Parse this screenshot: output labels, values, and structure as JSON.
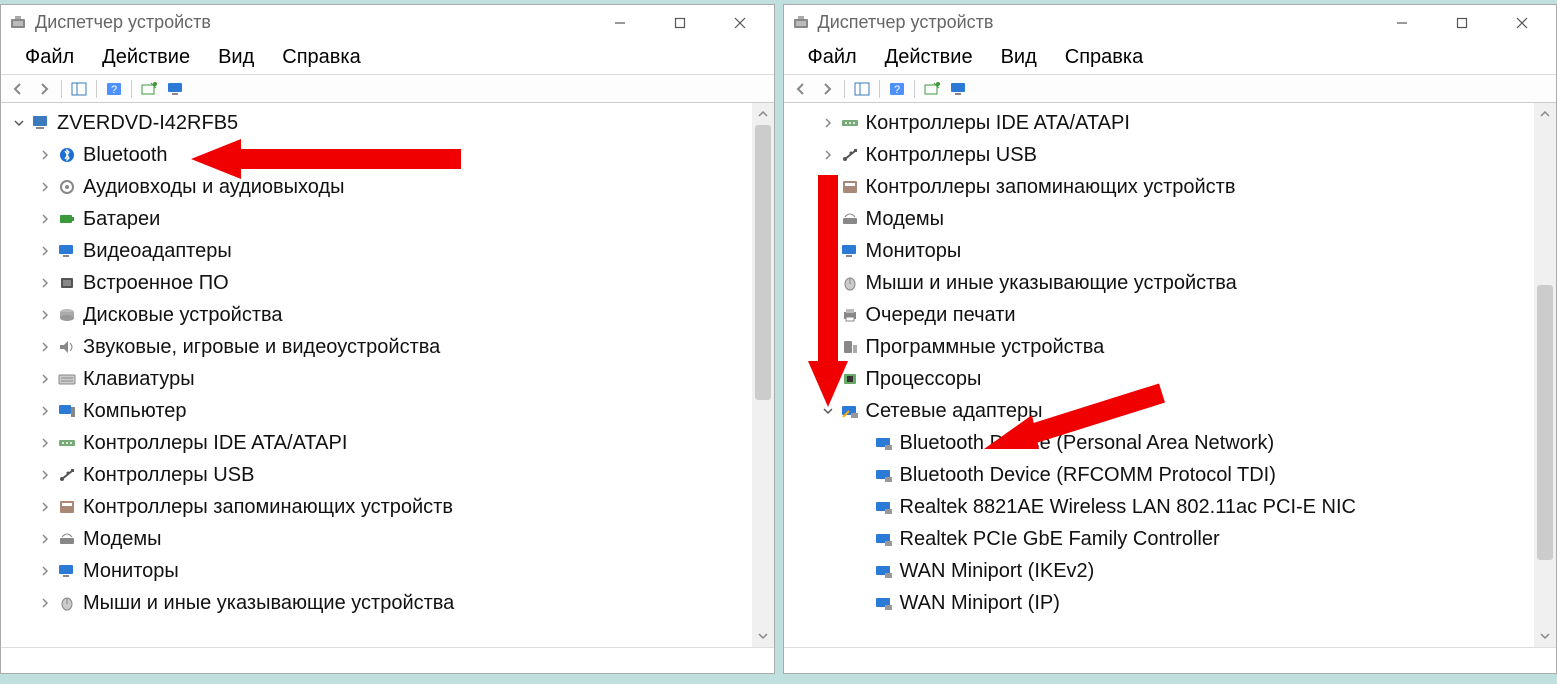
{
  "window_title": "Диспетчер устройств",
  "menubar": {
    "file": "Файл",
    "action": "Действие",
    "view": "Вид",
    "help": "Справка"
  },
  "left": {
    "root": "ZVERDVD-I42RFB5",
    "items": [
      {
        "label": "Bluetooth",
        "icon": "bluetooth"
      },
      {
        "label": "Аудиовходы и аудиовыходы",
        "icon": "audio"
      },
      {
        "label": "Батареи",
        "icon": "battery"
      },
      {
        "label": "Видеоадаптеры",
        "icon": "display"
      },
      {
        "label": "Встроенное ПО",
        "icon": "chip"
      },
      {
        "label": "Дисковые устройства",
        "icon": "disk"
      },
      {
        "label": "Звуковые, игровые и видеоустройства",
        "icon": "speaker"
      },
      {
        "label": "Клавиатуры",
        "icon": "keyboard"
      },
      {
        "label": "Компьютер",
        "icon": "computer"
      },
      {
        "label": "Контроллеры IDE ATA/ATAPI",
        "icon": "ide"
      },
      {
        "label": "Контроллеры USB",
        "icon": "usb"
      },
      {
        "label": "Контроллеры запоминающих устройств",
        "icon": "storage"
      },
      {
        "label": "Модемы",
        "icon": "modem"
      },
      {
        "label": "Мониторы",
        "icon": "monitor"
      },
      {
        "label": "Мыши и иные указывающие устройства",
        "icon": "mouse"
      }
    ]
  },
  "right": {
    "items": [
      {
        "label": "Контроллеры IDE ATA/ATAPI",
        "icon": "ide",
        "exp": "closed"
      },
      {
        "label": "Контроллеры USB",
        "icon": "usb",
        "exp": "closed"
      },
      {
        "label": "Контроллеры запоминающих устройств",
        "icon": "storage",
        "exp": "closed"
      },
      {
        "label": "Модемы",
        "icon": "modem",
        "exp": "closed"
      },
      {
        "label": "Мониторы",
        "icon": "monitor",
        "exp": "closed"
      },
      {
        "label": "Мыши и иные указывающие устройства",
        "icon": "mouse",
        "exp": "closed"
      },
      {
        "label": "Очереди печати",
        "icon": "print",
        "exp": "closed"
      },
      {
        "label": "Программные устройства",
        "icon": "software",
        "exp": "closed"
      },
      {
        "label": "Процессоры",
        "icon": "cpu",
        "exp": "closed"
      },
      {
        "label": "Сетевые адаптеры",
        "icon": "network",
        "exp": "open"
      }
    ],
    "network_children": [
      "Bluetooth Device (Personal Area Network)",
      "Bluetooth Device (RFCOMM Protocol TDI)",
      "Realtek 8821AE Wireless LAN 802.11ac PCI-E NIC",
      "Realtek PCIe GbE Family Controller",
      "WAN Miniport (IKEv2)",
      "WAN Miniport (IP)"
    ]
  }
}
